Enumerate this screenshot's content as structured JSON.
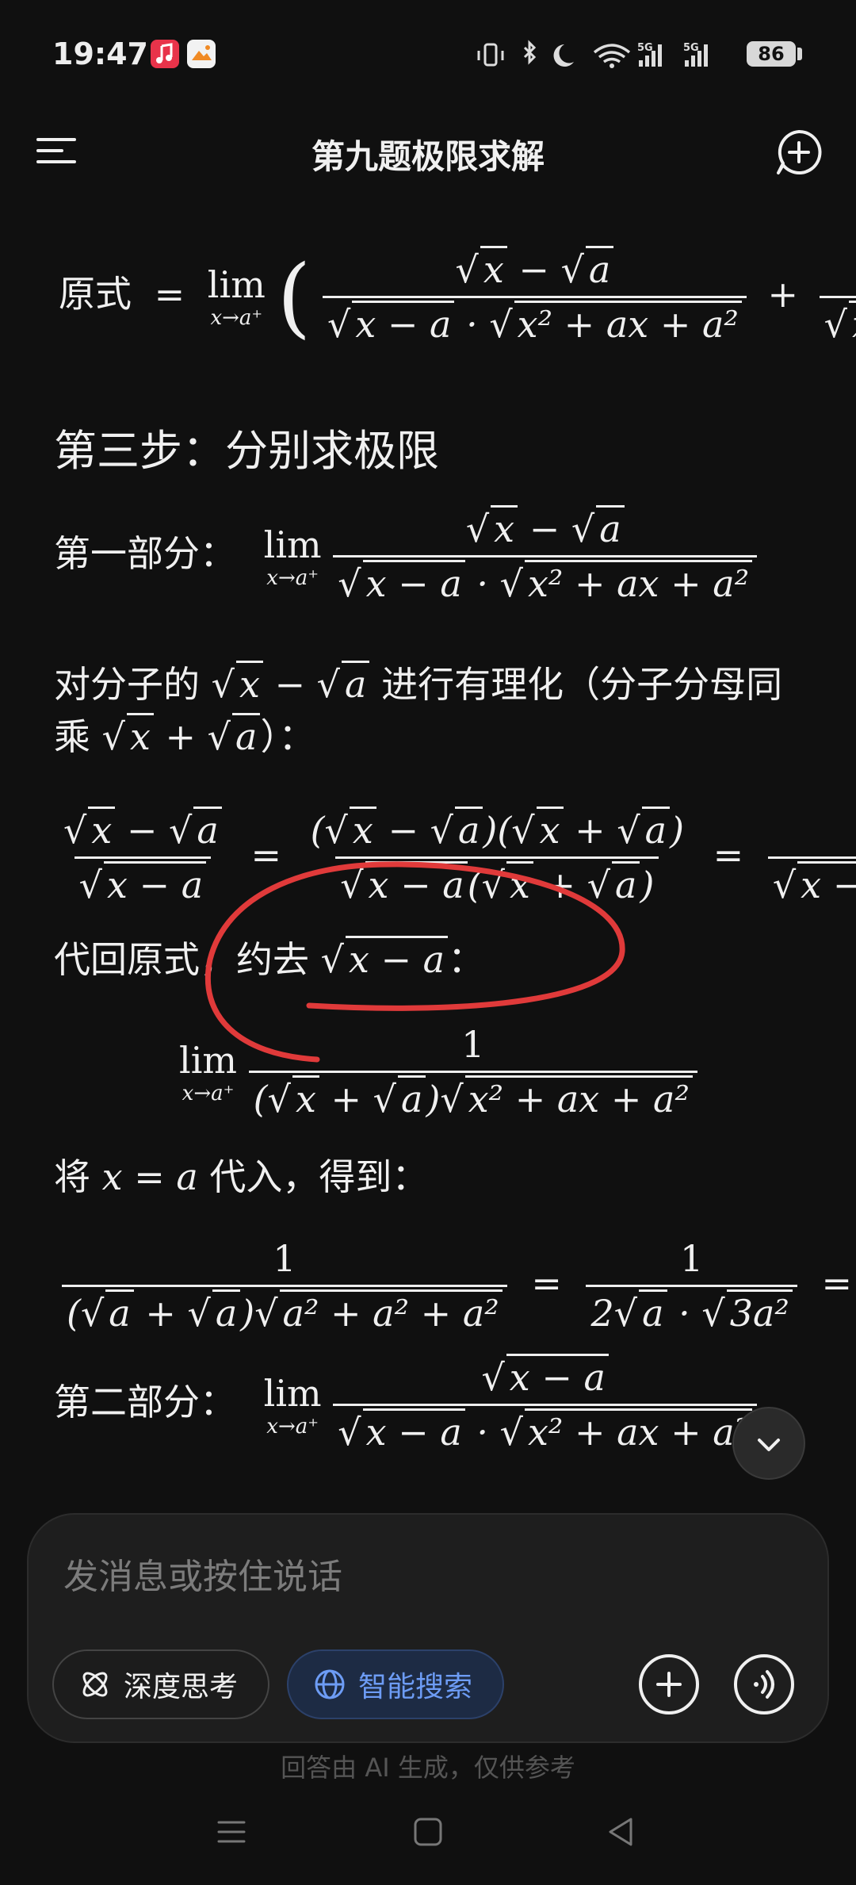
{
  "status_bar": {
    "time": "19:47",
    "battery": "86"
  },
  "header": {
    "title": "第九题极限求解"
  },
  "content": {
    "top_formula_label": "原式",
    "step_heading": "第三步：分别求极限",
    "part1_label": "第一部分：",
    "rationalize_line1_pre": "对分子的",
    "rationalize_line1_post": "进行有理化（分子分母同",
    "rationalize_line2_pre": "乘",
    "rationalize_line2_post": "）：",
    "substitute_back_pre": "代回原式，约去",
    "substitute_back_post": "：",
    "plug_in_pre": "将",
    "plug_in_post": "代入，得到：",
    "part2_label": "第二部分：",
    "lim_word": "lim",
    "lim_sub": "x→a⁺"
  },
  "input": {
    "placeholder": "发消息或按住说话",
    "deep_think": "深度思考",
    "smart_search": "智能搜索"
  },
  "footer": {
    "disclaimer": "回答由 AI 生成，仅供参考"
  },
  "icons": {
    "menu": "menu-icon",
    "new_chat": "new-chat-icon",
    "atom": "atom-icon",
    "globe": "globe-icon",
    "plus": "plus-icon",
    "voice": "voice-icon",
    "chevron": "chevron-down-icon"
  },
  "colors": {
    "background": "#101010",
    "accent": "#6d9cf5",
    "annotation": "#e03a3a"
  }
}
